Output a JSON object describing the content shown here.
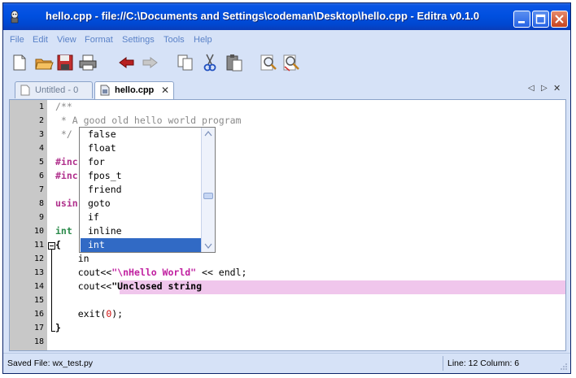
{
  "window": {
    "title": "hello.cpp - file://C:\\Documents and Settings\\codeman\\Desktop\\hello.cpp - Editra v0.1.0"
  },
  "menu": [
    "File",
    "Edit",
    "View",
    "Format",
    "Settings",
    "Tools",
    "Help"
  ],
  "toolbar": {
    "icons": [
      "new-file-icon",
      "open-folder-icon",
      "save-icon",
      "print-icon",
      "undo-icon",
      "redo-icon",
      "copy-icon",
      "cut-icon",
      "paste-icon",
      "find-icon",
      "find-replace-icon"
    ]
  },
  "tabs": [
    {
      "label": "Untitled - 0",
      "active": false
    },
    {
      "label": "hello.cpp",
      "active": true
    }
  ],
  "tab_controls": {
    "prev": "◁",
    "next": "▷",
    "close": "✕"
  },
  "editor": {
    "line_numbers": [
      "1",
      "2",
      "3",
      "4",
      "5",
      "6",
      "7",
      "8",
      "9",
      "10",
      "11",
      "12",
      "13",
      "14",
      "15",
      "16",
      "17",
      "18"
    ],
    "lines": {
      "l1": "/**",
      "l2": " * A good old hello world program",
      "l3": " */",
      "l5": "#inc",
      "l6": "#inc",
      "l8": "usin",
      "l10": "int ",
      "l11": "{",
      "l12": "    in",
      "l13_a": "    cout<<",
      "l13_b": "\"\\nHello World\"",
      "l13_c": " << endl;",
      "l14_a": "    cout<<",
      "l14_b": "\"Unclosed string",
      "l16_a": "    exit(",
      "l16_b": "0",
      "l16_c": ");",
      "l17": "}"
    }
  },
  "autocomplete": {
    "items": [
      "false",
      "float",
      "for",
      "fpos_t",
      "friend",
      "goto",
      "if",
      "inline",
      "int"
    ],
    "selected": "int"
  },
  "status": {
    "left": "Saved File: wx_test.py",
    "right": "Line: 12  Column: 6"
  },
  "colors": {
    "title_bar": "#0050e0",
    "menu_text": "#5a82c8",
    "keyword": "#2a8a4a",
    "preprocessor": "#b0308c",
    "string": "#c020a0",
    "unclosed_highlight": "#f0c6ec",
    "selection": "#316ac5"
  }
}
